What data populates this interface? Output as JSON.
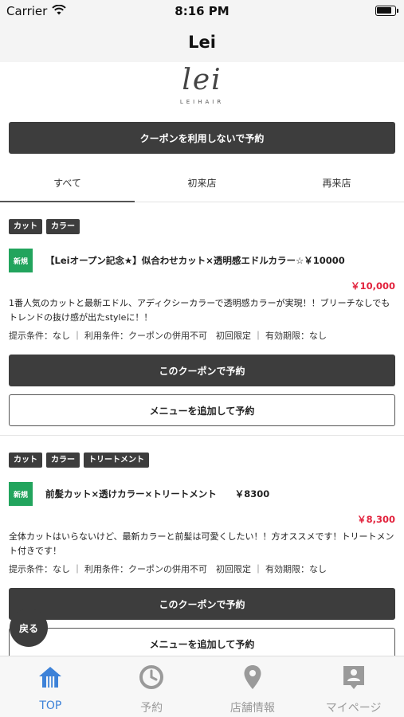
{
  "status_bar": {
    "carrier": "Carrier",
    "time": "8:16 PM"
  },
  "nav": {
    "title": "Lei"
  },
  "logo": {
    "script": "lei",
    "sub": "LEIHAIR"
  },
  "no_coupon_button": "クーポンを利用しないで予約",
  "tabs": [
    {
      "label": "すべて",
      "active": true
    },
    {
      "label": "初来店",
      "active": false
    },
    {
      "label": "再来店",
      "active": false
    }
  ],
  "coupons": [
    {
      "tags": [
        "カット",
        "カラー"
      ],
      "badge": "新規",
      "title": "【Leiオープン記念★】似合わせカット×透明感エドルカラー☆￥10000",
      "price": "￥10,000",
      "description": "1番人気のカットと最新エドル、アディクシーカラーで透明感カラーが実現！！ブリーチなしでもトレンドの抜け感が出たstyleに！！",
      "conditions": "提示条件：なし ｜ 利用条件：クーポンの併用不可　初回限定 ｜ 有効期限：なし",
      "use_button": "このクーポンで予約",
      "add_button": "メニューを追加して予約"
    },
    {
      "tags": [
        "カット",
        "カラー",
        "トリートメント"
      ],
      "badge": "新規",
      "title": "前髪カット×透けカラー×トリートメント　　￥8300",
      "price": "￥8,300",
      "description": "全体カットはいらないけど、最新カラーと前髪は可愛くしたい！！方オススメです！トリートメント付きです！",
      "conditions": "提示条件：なし ｜ 利用条件：クーポンの併用不可　初回限定 ｜ 有効期限：なし",
      "use_button": "このクーポンで予約",
      "add_button": "メニューを追加して予約"
    }
  ],
  "back_button": "戻る",
  "tab_bar": [
    {
      "label": "TOP",
      "icon": "home-icon",
      "active": true
    },
    {
      "label": "予約",
      "icon": "clock-icon",
      "active": false
    },
    {
      "label": "店舗情報",
      "icon": "map-pin-icon",
      "active": false
    },
    {
      "label": "マイページ",
      "icon": "profile-card-icon",
      "active": false
    }
  ],
  "colors": {
    "accent": "#3d82d8",
    "price": "#e2223c",
    "new_badge": "#22a45d",
    "button_dark": "#3d3d3d"
  }
}
